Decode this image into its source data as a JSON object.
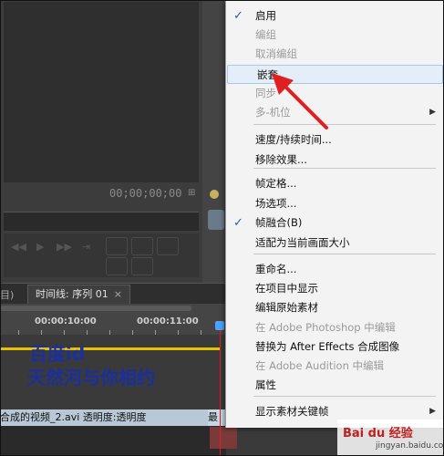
{
  "monitor": {
    "timecode": "00;00;00;00",
    "fit_icon": "settings-icon"
  },
  "timeline": {
    "prev_tab_label": "目)",
    "tab_label": "时间线: 序列 01",
    "tab_close": "×",
    "ruler_time_1": "00:00:10:00",
    "ruler_time_2": "00:00:11:00",
    "overlay_line_1": "百度id",
    "overlay_line_2": "天然河与你相约",
    "clip_name": "合成的视频_2.avi",
    "clip_opacity": "透明度:透明度",
    "clip2_label": "最"
  },
  "menu": {
    "items": [
      {
        "label": "启用",
        "checked": true,
        "disabled": false
      },
      {
        "label": "编组",
        "checked": false,
        "disabled": true
      },
      {
        "label": "取消编组",
        "checked": false,
        "disabled": true
      },
      {
        "label": "嵌套",
        "checked": false,
        "disabled": false,
        "highlight": true
      },
      {
        "label": "同步",
        "checked": false,
        "disabled": true
      },
      {
        "label": "多-机位",
        "checked": false,
        "disabled": true,
        "submenu": true
      },
      {
        "label": "速度/持续时间...",
        "checked": false,
        "disabled": false
      },
      {
        "label": "移除效果...",
        "checked": false,
        "disabled": false
      },
      {
        "label": "帧定格...",
        "checked": false,
        "disabled": false
      },
      {
        "label": "场选项...",
        "checked": false,
        "disabled": false
      },
      {
        "label": "帧融合(B)",
        "checked": true,
        "disabled": false
      },
      {
        "label": "适配为当前画面大小",
        "checked": false,
        "disabled": false
      },
      {
        "label": "重命名...",
        "checked": false,
        "disabled": false
      },
      {
        "label": "在项目中显示",
        "checked": false,
        "disabled": false
      },
      {
        "label": "编辑原始素材",
        "checked": false,
        "disabled": false
      },
      {
        "label": "在 Adobe Photoshop 中编辑",
        "checked": false,
        "disabled": true
      },
      {
        "label": "替换为 After Effects 合成图像",
        "checked": false,
        "disabled": false
      },
      {
        "label": "在 Adobe Audition 中编辑",
        "checked": false,
        "disabled": true
      },
      {
        "label": "属性",
        "checked": false,
        "disabled": false
      },
      {
        "label": "显示素材关键帧",
        "checked": false,
        "disabled": false,
        "submenu": true
      }
    ],
    "check_glyph": "✓",
    "submenu_glyph": "▶"
  },
  "watermark": {
    "brand": "Bai du 经验",
    "domain": "jingyan.baidu.com"
  },
  "colors": {
    "highlight": "#e4eef8",
    "overlay_text": "#1a2fa0",
    "annotation_arrow": "#e02020"
  }
}
